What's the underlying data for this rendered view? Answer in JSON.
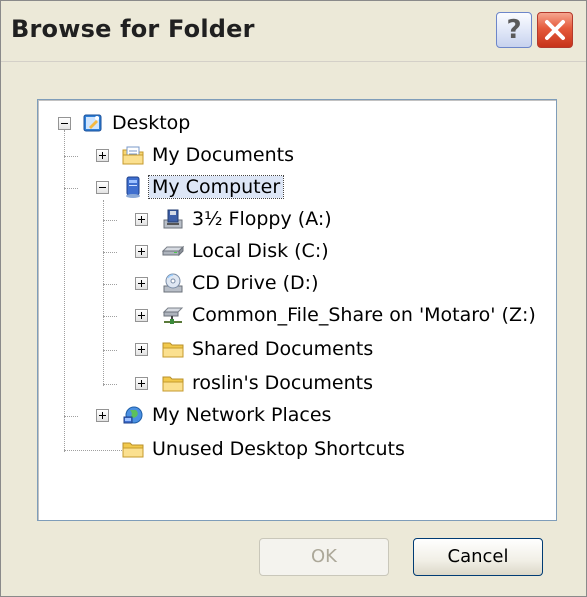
{
  "dialog": {
    "title": "Browse for Folder",
    "help_glyph": "?"
  },
  "tree": {
    "items": [
      {
        "label": "Desktop",
        "icon": "desktop-icon",
        "expander": "minus"
      },
      {
        "label": "My Documents",
        "icon": "documents-folder-icon",
        "expander": "plus"
      },
      {
        "label": "My Computer",
        "icon": "computer-icon",
        "expander": "minus",
        "selected": true
      },
      {
        "label": "3½ Floppy (A:)",
        "icon": "floppy-drive-icon",
        "expander": "plus"
      },
      {
        "label": "Local Disk (C:)",
        "icon": "local-disk-icon",
        "expander": "plus"
      },
      {
        "label": "CD Drive (D:)",
        "icon": "cd-drive-icon",
        "expander": "plus"
      },
      {
        "label": "Common_File_Share on 'Motaro' (Z:)",
        "icon": "network-drive-icon",
        "expander": "plus"
      },
      {
        "label": "Shared Documents",
        "icon": "folder-icon",
        "expander": "plus"
      },
      {
        "label": "roslin's Documents",
        "icon": "folder-icon",
        "expander": "plus"
      },
      {
        "label": "My Network Places",
        "icon": "network-places-icon",
        "expander": "plus"
      },
      {
        "label": "Unused Desktop Shortcuts",
        "icon": "folder-icon",
        "expander": "none"
      }
    ]
  },
  "buttons": {
    "ok_label": "OK",
    "ok_enabled": false,
    "cancel_label": "Cancel"
  },
  "colors": {
    "dialog_bg": "#ece9d8",
    "close_button": "#e55b3c",
    "selection_bg": "#dde6f6"
  }
}
